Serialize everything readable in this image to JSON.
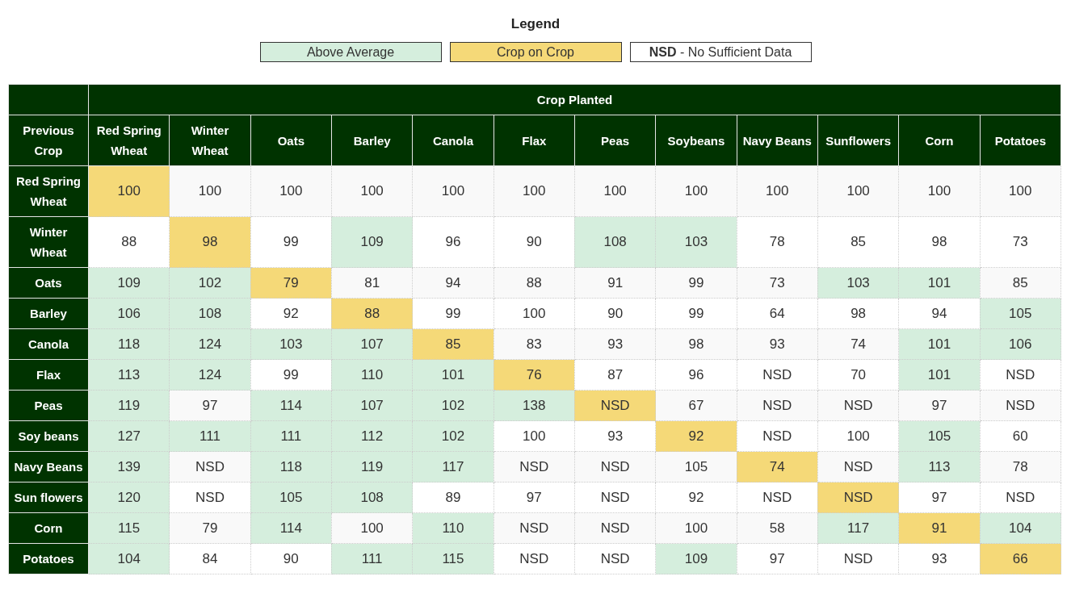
{
  "legend": {
    "title": "Legend",
    "items": [
      {
        "label": "Above Average",
        "color": "#d5eedd"
      },
      {
        "label": "Crop on Crop",
        "color": "#f5d978"
      },
      {
        "label": "**NSD** - No Sufficient Data",
        "color": "#ffffff"
      }
    ]
  },
  "table": {
    "group_heading": "Crop Planted",
    "corner_heading": "Previous Crop",
    "columns": [
      "Red Spring Wheat",
      "Winter Wheat",
      "Oats",
      "Barley",
      "Canola",
      "Flax",
      "Peas",
      "Soybeans",
      "Navy Beans",
      "Sunflowers",
      "Corn",
      "Potatoes"
    ],
    "rows": [
      {
        "label": "Red Spring Wheat",
        "cells": [
          {
            "value": "100",
            "color": "#f5d978"
          },
          {
            "value": "100",
            "color": "#f9f9f9"
          },
          {
            "value": "100",
            "color": "#f9f9f9"
          },
          {
            "value": "100",
            "color": "#f9f9f9"
          },
          {
            "value": "100",
            "color": "#f9f9f9"
          },
          {
            "value": "100",
            "color": "#f9f9f9"
          },
          {
            "value": "100",
            "color": "#f9f9f9"
          },
          {
            "value": "100",
            "color": "#f9f9f9"
          },
          {
            "value": "100",
            "color": "#f9f9f9"
          },
          {
            "value": "100",
            "color": "#f9f9f9"
          },
          {
            "value": "100",
            "color": "#f9f9f9"
          },
          {
            "value": "100",
            "color": "#f9f9f9"
          }
        ]
      },
      {
        "label": "Winter Wheat",
        "cells": [
          {
            "value": "88",
            "color": "#ffffff"
          },
          {
            "value": "98",
            "color": "#f5d978"
          },
          {
            "value": "99",
            "color": "#ffffff"
          },
          {
            "value": "109",
            "color": "#d5eedd"
          },
          {
            "value": "96",
            "color": "#ffffff"
          },
          {
            "value": "90",
            "color": "#ffffff"
          },
          {
            "value": "108",
            "color": "#d5eedd"
          },
          {
            "value": "103",
            "color": "#d5eedd"
          },
          {
            "value": "78",
            "color": "#ffffff"
          },
          {
            "value": "85",
            "color": "#ffffff"
          },
          {
            "value": "98",
            "color": "#ffffff"
          },
          {
            "value": "73",
            "color": "#ffffff"
          }
        ]
      },
      {
        "label": "Oats",
        "cells": [
          {
            "value": "109",
            "color": "#d5eedd"
          },
          {
            "value": "102",
            "color": "#d5eedd"
          },
          {
            "value": "79",
            "color": "#f5d978"
          },
          {
            "value": "81",
            "color": "#f9f9f9"
          },
          {
            "value": "94",
            "color": "#f9f9f9"
          },
          {
            "value": "88",
            "color": "#f9f9f9"
          },
          {
            "value": "91",
            "color": "#f9f9f9"
          },
          {
            "value": "99",
            "color": "#f9f9f9"
          },
          {
            "value": "73",
            "color": "#f9f9f9"
          },
          {
            "value": "103",
            "color": "#d5eedd"
          },
          {
            "value": "101",
            "color": "#d5eedd"
          },
          {
            "value": "85",
            "color": "#f9f9f9"
          }
        ]
      },
      {
        "label": "Barley",
        "cells": [
          {
            "value": "106",
            "color": "#d5eedd"
          },
          {
            "value": "108",
            "color": "#d5eedd"
          },
          {
            "value": "92",
            "color": "#ffffff"
          },
          {
            "value": "88",
            "color": "#f5d978"
          },
          {
            "value": "99",
            "color": "#ffffff"
          },
          {
            "value": "100",
            "color": "#ffffff"
          },
          {
            "value": "90",
            "color": "#ffffff"
          },
          {
            "value": "99",
            "color": "#ffffff"
          },
          {
            "value": "64",
            "color": "#ffffff"
          },
          {
            "value": "98",
            "color": "#ffffff"
          },
          {
            "value": "94",
            "color": "#ffffff"
          },
          {
            "value": "105",
            "color": "#d5eedd"
          }
        ]
      },
      {
        "label": "Canola",
        "cells": [
          {
            "value": "118",
            "color": "#d5eedd"
          },
          {
            "value": "124",
            "color": "#d5eedd"
          },
          {
            "value": "103",
            "color": "#d5eedd"
          },
          {
            "value": "107",
            "color": "#d5eedd"
          },
          {
            "value": "85",
            "color": "#f5d978"
          },
          {
            "value": "83",
            "color": "#f9f9f9"
          },
          {
            "value": "93",
            "color": "#f9f9f9"
          },
          {
            "value": "98",
            "color": "#f9f9f9"
          },
          {
            "value": "93",
            "color": "#f9f9f9"
          },
          {
            "value": "74",
            "color": "#f9f9f9"
          },
          {
            "value": "101",
            "color": "#d5eedd"
          },
          {
            "value": "106",
            "color": "#d5eedd"
          }
        ]
      },
      {
        "label": "Flax",
        "cells": [
          {
            "value": "113",
            "color": "#d5eedd"
          },
          {
            "value": "124",
            "color": "#d5eedd"
          },
          {
            "value": "99",
            "color": "#ffffff"
          },
          {
            "value": "110",
            "color": "#d5eedd"
          },
          {
            "value": "101",
            "color": "#d5eedd"
          },
          {
            "value": "76",
            "color": "#f5d978"
          },
          {
            "value": "87",
            "color": "#ffffff"
          },
          {
            "value": "96",
            "color": "#ffffff"
          },
          {
            "value": "NSD",
            "color": "#ffffff"
          },
          {
            "value": "70",
            "color": "#ffffff"
          },
          {
            "value": "101",
            "color": "#d5eedd"
          },
          {
            "value": "NSD",
            "color": "#ffffff"
          }
        ]
      },
      {
        "label": "Peas",
        "cells": [
          {
            "value": "119",
            "color": "#d5eedd"
          },
          {
            "value": "97",
            "color": "#f9f9f9"
          },
          {
            "value": "114",
            "color": "#d5eedd"
          },
          {
            "value": "107",
            "color": "#d5eedd"
          },
          {
            "value": "102",
            "color": "#d5eedd"
          },
          {
            "value": "138",
            "color": "#d5eedd"
          },
          {
            "value": "NSD",
            "color": "#f5d978"
          },
          {
            "value": "67",
            "color": "#f9f9f9"
          },
          {
            "value": "NSD",
            "color": "#f9f9f9"
          },
          {
            "value": "NSD",
            "color": "#f9f9f9"
          },
          {
            "value": "97",
            "color": "#f9f9f9"
          },
          {
            "value": "NSD",
            "color": "#f9f9f9"
          }
        ]
      },
      {
        "label": "Soy beans",
        "cells": [
          {
            "value": "127",
            "color": "#d5eedd"
          },
          {
            "value": "111",
            "color": "#d5eedd"
          },
          {
            "value": "111",
            "color": "#d5eedd"
          },
          {
            "value": "112",
            "color": "#d5eedd"
          },
          {
            "value": "102",
            "color": "#d5eedd"
          },
          {
            "value": "100",
            "color": "#ffffff"
          },
          {
            "value": "93",
            "color": "#ffffff"
          },
          {
            "value": "92",
            "color": "#f5d978"
          },
          {
            "value": "NSD",
            "color": "#ffffff"
          },
          {
            "value": "100",
            "color": "#ffffff"
          },
          {
            "value": "105",
            "color": "#d5eedd"
          },
          {
            "value": "60",
            "color": "#ffffff"
          }
        ]
      },
      {
        "label": "Navy Beans",
        "cells": [
          {
            "value": "139",
            "color": "#d5eedd"
          },
          {
            "value": "NSD",
            "color": "#f9f9f9"
          },
          {
            "value": "118",
            "color": "#d5eedd"
          },
          {
            "value": "119",
            "color": "#d5eedd"
          },
          {
            "value": "117",
            "color": "#d5eedd"
          },
          {
            "value": "NSD",
            "color": "#f9f9f9"
          },
          {
            "value": "NSD",
            "color": "#f9f9f9"
          },
          {
            "value": "105",
            "color": "#f9f9f9"
          },
          {
            "value": "74",
            "color": "#f5d978"
          },
          {
            "value": "NSD",
            "color": "#f9f9f9"
          },
          {
            "value": "113",
            "color": "#d5eedd"
          },
          {
            "value": "78",
            "color": "#f9f9f9"
          }
        ]
      },
      {
        "label": "Sun flowers",
        "cells": [
          {
            "value": "120",
            "color": "#d5eedd"
          },
          {
            "value": "NSD",
            "color": "#ffffff"
          },
          {
            "value": "105",
            "color": "#d5eedd"
          },
          {
            "value": "108",
            "color": "#d5eedd"
          },
          {
            "value": "89",
            "color": "#ffffff"
          },
          {
            "value": "97",
            "color": "#ffffff"
          },
          {
            "value": "NSD",
            "color": "#ffffff"
          },
          {
            "value": "92",
            "color": "#ffffff"
          },
          {
            "value": "NSD",
            "color": "#ffffff"
          },
          {
            "value": "NSD",
            "color": "#f5d978"
          },
          {
            "value": "97",
            "color": "#ffffff"
          },
          {
            "value": "NSD",
            "color": "#ffffff"
          }
        ]
      },
      {
        "label": "Corn",
        "cells": [
          {
            "value": "115",
            "color": "#d5eedd"
          },
          {
            "value": "79",
            "color": "#f9f9f9"
          },
          {
            "value": "114",
            "color": "#d5eedd"
          },
          {
            "value": "100",
            "color": "#f9f9f9"
          },
          {
            "value": "110",
            "color": "#d5eedd"
          },
          {
            "value": "NSD",
            "color": "#f9f9f9"
          },
          {
            "value": "NSD",
            "color": "#f9f9f9"
          },
          {
            "value": "100",
            "color": "#f9f9f9"
          },
          {
            "value": "58",
            "color": "#f9f9f9"
          },
          {
            "value": "117",
            "color": "#d5eedd"
          },
          {
            "value": "91",
            "color": "#f5d978"
          },
          {
            "value": "104",
            "color": "#d5eedd"
          }
        ]
      },
      {
        "label": "Potatoes",
        "cells": [
          {
            "value": "104",
            "color": "#d5eedd"
          },
          {
            "value": "84",
            "color": "#ffffff"
          },
          {
            "value": "90",
            "color": "#ffffff"
          },
          {
            "value": "111",
            "color": "#d5eedd"
          },
          {
            "value": "115",
            "color": "#d5eedd"
          },
          {
            "value": "NSD",
            "color": "#ffffff"
          },
          {
            "value": "NSD",
            "color": "#ffffff"
          },
          {
            "value": "109",
            "color": "#d5eedd"
          },
          {
            "value": "97",
            "color": "#ffffff"
          },
          {
            "value": "NSD",
            "color": "#ffffff"
          },
          {
            "value": "93",
            "color": "#ffffff"
          },
          {
            "value": "66",
            "color": "#f5d978"
          }
        ]
      }
    ]
  }
}
